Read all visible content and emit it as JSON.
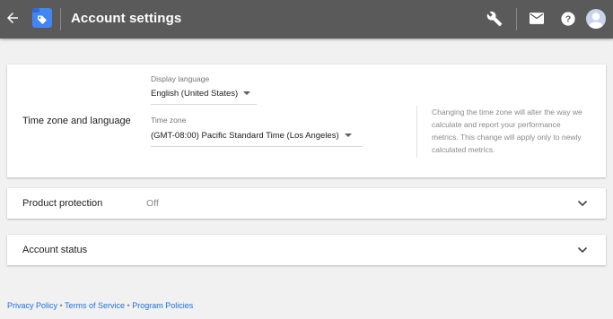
{
  "header": {
    "title": "Account settings",
    "colors": {
      "bar": "#5a5a5a",
      "logo": "#4285f4"
    },
    "icons": [
      "arrow-back-icon",
      "tag-logo-icon",
      "wrench-icon",
      "mail-icon",
      "help-icon",
      "avatar-icon"
    ]
  },
  "timezone_card": {
    "label": "Time zone and language",
    "display_language": {
      "label": "Display language",
      "value": "English (United States)"
    },
    "time_zone": {
      "label": "Time zone",
      "value": "(GMT-08:00) Pacific Standard Time (Los Angeles)"
    },
    "info": "Changing the time zone will alter the way we calculate and report your performance metrics. This change will apply only to newly calculated metrics."
  },
  "product_protection": {
    "label": "Product protection",
    "value": "Off"
  },
  "account_status": {
    "label": "Account status"
  },
  "footer": {
    "privacy": "Privacy Policy",
    "terms": "Terms of Service",
    "program": "Program Policies",
    "separator": " • "
  }
}
